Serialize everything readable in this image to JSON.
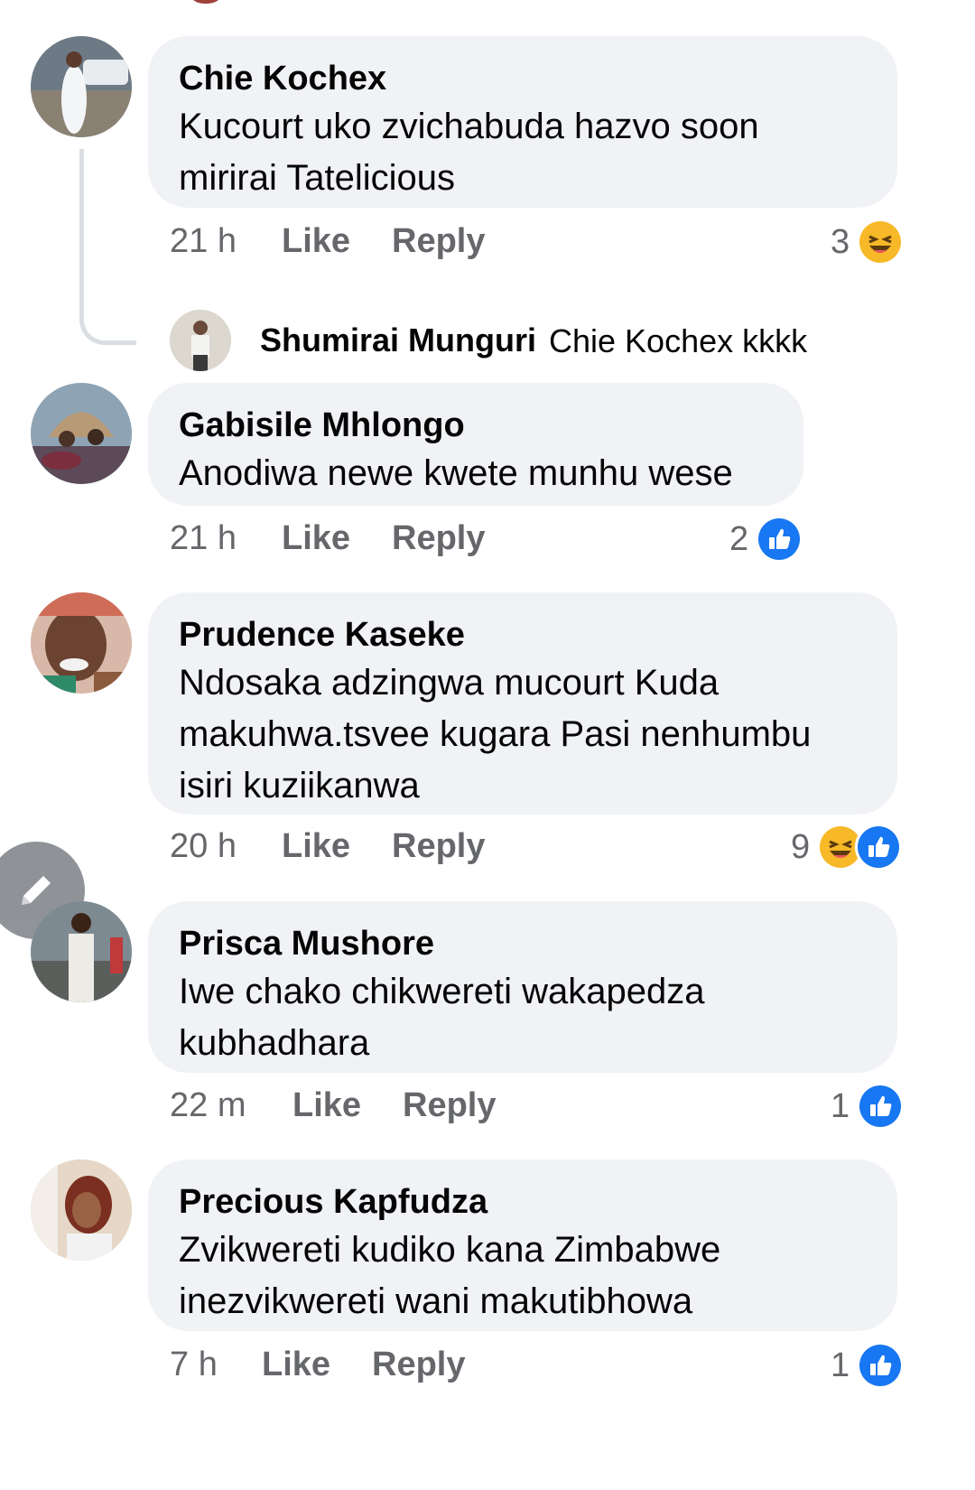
{
  "comments": [
    {
      "author": "Chie Kochex",
      "text_lines": [
        "Kucourt uko zvichabuda hazvo soon",
        "mirirai Tatelicious"
      ],
      "time": "21 h",
      "like_label": "Like",
      "reply_label": "Reply",
      "reaction_count": "3",
      "reaction_icons": [
        "haha-icon"
      ],
      "reply": {
        "author": "Shumirai Munguri",
        "text": "Chie Kochex kkkk"
      }
    },
    {
      "author": "Gabisile Mhlongo",
      "text_lines": [
        "Anodiwa newe kwete munhu wese"
      ],
      "time": "21 h",
      "like_label": "Like",
      "reply_label": "Reply",
      "reaction_count": "2",
      "reaction_icons": [
        "like-icon"
      ]
    },
    {
      "author": "Prudence Kaseke",
      "text_lines": [
        "Ndosaka adzingwa mucourt Kuda",
        "makuhwa.tsvee kugara Pasi nenhumbu",
        "isiri kuziikanwa"
      ],
      "time": "20 h",
      "like_label": "Like",
      "reply_label": "Reply",
      "reaction_count": "9",
      "reaction_icons": [
        "haha-icon",
        "like-icon"
      ]
    },
    {
      "author": "Prisca Mushore",
      "text_lines": [
        "Iwe chako chikwereti wakapedza",
        "kubhadhara"
      ],
      "time": "22 m",
      "like_label": "Like",
      "reply_label": "Reply",
      "reaction_count": "1",
      "reaction_icons": [
        "like-icon"
      ]
    },
    {
      "author": "Precious Kapfudza",
      "text_lines": [
        "Zvikwereti kudiko kana Zimbabwe",
        "inezvikwereti wani makutibhowa"
      ],
      "time": "7 h",
      "like_label": "Like",
      "reply_label": "Reply",
      "reaction_count": "1",
      "reaction_icons": [
        "like-icon"
      ]
    }
  ],
  "colors": {
    "bubble_bg": "#f0f2f5",
    "meta_text": "#65676b",
    "like_blue": "#1877f2",
    "haha_yellow": "#f7b928"
  },
  "floating_button_icon": "pencil-icon"
}
